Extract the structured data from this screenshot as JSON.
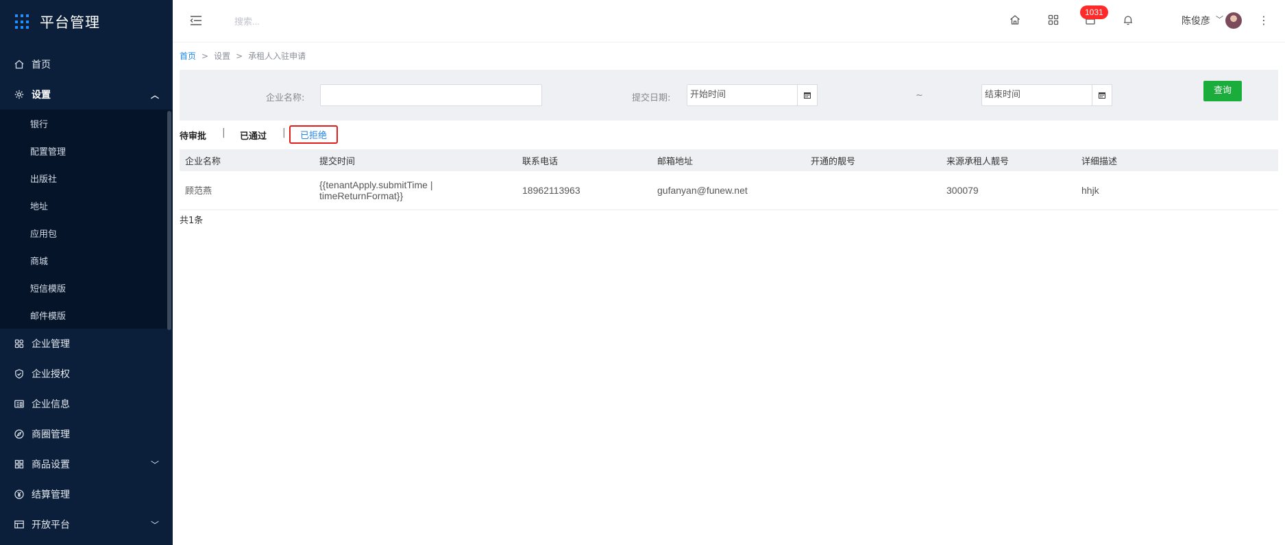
{
  "app": {
    "title": "平台管理"
  },
  "sidebar": {
    "items": [
      {
        "label": "首页",
        "icon": "home-icon"
      },
      {
        "label": "设置",
        "icon": "gear-icon",
        "expanded": true,
        "children": [
          "银行",
          "配置管理",
          "出版社",
          "地址",
          "应用包",
          "商城",
          "短信模版",
          "邮件模版"
        ]
      },
      {
        "label": "企业管理",
        "icon": "building-icon"
      },
      {
        "label": "企业授权",
        "icon": "shield-icon"
      },
      {
        "label": "企业信息",
        "icon": "id-card-icon"
      },
      {
        "label": "商圈管理",
        "icon": "compass-icon"
      },
      {
        "label": "商品设置",
        "icon": "grid-icon"
      },
      {
        "label": "结算管理",
        "icon": "yuan-icon"
      },
      {
        "label": "开放平台",
        "icon": "table-icon"
      }
    ]
  },
  "header": {
    "search_placeholder": "搜索...",
    "badge_count": "1031",
    "username": "陈俊彦"
  },
  "breadcrumb": {
    "home": "首页",
    "level1": "设置",
    "current": "承租人入驻申请",
    "sep": ">"
  },
  "filter": {
    "company_label": "企业名称:",
    "company_value": "",
    "date_label": "提交日期:",
    "start_placeholder": "开始时间",
    "tilde": "~",
    "end_placeholder": "结束时间",
    "query_label": "查询"
  },
  "tabs": {
    "pending": "待审批",
    "approved": "已通过",
    "rejected": "已拒绝",
    "sep": "|"
  },
  "table": {
    "headers": [
      "企业名称",
      "提交时间",
      "联系电话",
      "邮箱地址",
      "开通的靓号",
      "来源承租人靓号",
      "详细描述"
    ],
    "rows": [
      [
        "顾范燕",
        "{{tenantApply.submitTime | timeReturnFormat}}",
        "18962113963",
        "gufanyan@funew.net",
        "",
        "300079",
        "hhjk"
      ]
    ]
  },
  "footer": {
    "total": "共1条"
  },
  "colors": {
    "sidebar_bg": "#0b1f3a",
    "accent": "#1f86e6",
    "query_btn": "#1aad3c",
    "badge": "#ff2a2a",
    "active_tab_outline": "#e31b1b"
  }
}
